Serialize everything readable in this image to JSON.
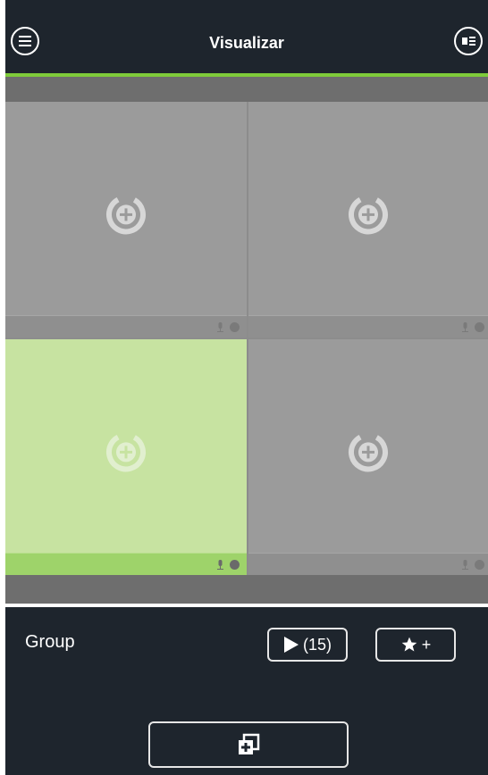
{
  "header": {
    "title": "Visualizar"
  },
  "grid": {
    "cells": [
      {
        "name": "cell-1"
      },
      {
        "name": "cell-2"
      },
      {
        "name": "cell-3"
      },
      {
        "name": "cell-4"
      }
    ],
    "active_cell_index": 2
  },
  "bottom": {
    "group_label": "Group",
    "play_count": "(15)",
    "favorite_plus": "+"
  },
  "colors": {
    "accent": "#7fcb3a",
    "background": "#1e252d",
    "active_cell": "#c7e3a1",
    "cell": "#9b9b9b"
  }
}
